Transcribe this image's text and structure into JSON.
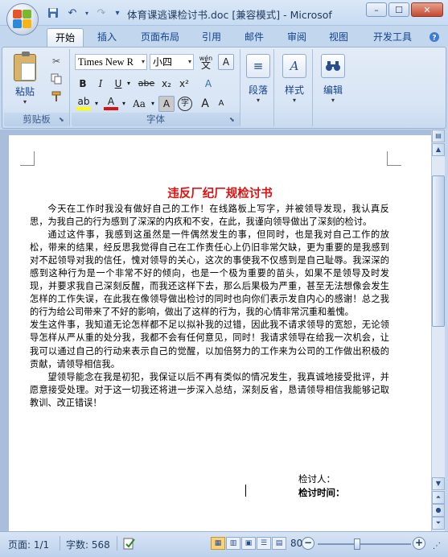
{
  "window": {
    "title": "体育课逃课检讨书.doc [兼容模式] - Microsof",
    "controls": {
      "minimize": "–",
      "maximize": "☐",
      "close": "✕"
    }
  },
  "qat": {
    "save_icon": "save-icon",
    "undo": "↶",
    "redo": "↷",
    "customize": "▾"
  },
  "tabs": [
    "开始",
    "插入",
    "页面布局",
    "引用",
    "邮件",
    "审阅",
    "视图",
    "开发工具"
  ],
  "active_tab": "开始",
  "ribbon": {
    "clipboard": {
      "label": "剪贴板",
      "paste": "粘贴"
    },
    "font": {
      "label": "字体",
      "name": "Times New R",
      "size": "小四",
      "wen": "wén",
      "wen_char": "文",
      "box_a": "A",
      "bold": "B",
      "italic": "I",
      "underline": "U",
      "strike": "abe",
      "subscript": "x₂",
      "superscript": "x²",
      "clear": "A",
      "highlight": "ab",
      "fontcolor": "A",
      "case": "Aa",
      "shade": "A",
      "enclose": "字",
      "grow": "A",
      "shrink": "A",
      "highlight_color": "#ffff00",
      "fontcolor_color": "#e01010"
    },
    "paragraph": {
      "label": "段落"
    },
    "styles": {
      "label": "样式"
    },
    "editing": {
      "label": "编辑"
    }
  },
  "document": {
    "title": "违反厂纪厂规检讨书",
    "paragraphs": [
      "今天在工作时我没有做好自己的工作！在线路板上写字，并被领导发现，我认真反思，为我自己的行为感到了深深的内疚和不安，在此，我谨向领导做出了深刻的检讨。",
      "通过这件事，我感到这虽然是一件偶然发生的事，但同时，也是我对自己工作的放松，带来的结果，经反思我觉得自己在工作责任心上仍旧非常欠缺，更为重要的是我感到对不起领导对我的信任，愧对领导的关心，这次的事使我不仅感到是自己耻辱。我深深的感到这种行为是一个非常不好的倾向，也是一个极为重要的苗头，如果不是领导及时发现，并要求我自己深刻反醒，而我还这样下去，那么后果极为严重，甚至无法想像会发生怎样的工作失误，在此我在像领导做出检讨的同时也向你们表示发自内心的感谢！总之我的行为给公司带来了不好的影响，做出了这样的行为，我的心情非常沉重和羞愧。",
      "发生这件事，我知道无论怎样都不足以拟补我的过错，因此我不请求领导的宽恕，无论领导怎样从严从重的处分我，我都不会有任何意见，同时！我请求领导在给我一次机会，让我可以通过自己的行动来表示自己的觉醒，以加倍努力的工作来为公司的工作做出积极的贡献，请领导相信我。",
      "望领导能念在我是初犯，我保证以后不再有类似的情况发生，我真诚地接受批评，并愿意接受处理。对于这一切我还将进一步深入总结，深刻反省，恳请领导相信我能够记取教训、改正错误！"
    ],
    "signer_label": "检讨人：",
    "time_label": "检讨时间："
  },
  "statusbar": {
    "page": "页面: 1/1",
    "words": "字数: 568",
    "zoom": "80%",
    "zoom_fraction": 0.42,
    "minus": "−",
    "plus": "+"
  }
}
